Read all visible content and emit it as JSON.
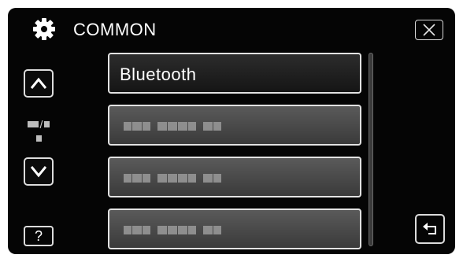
{
  "header": {
    "title": "COMMON",
    "icon": "gear-icon"
  },
  "menu": {
    "items": [
      {
        "label": "Bluetooth",
        "selected": true
      },
      {
        "label": "",
        "placeholder": true
      },
      {
        "label": "",
        "placeholder": true
      },
      {
        "label": "",
        "placeholder": true
      }
    ]
  },
  "nav": {
    "help_label": "?",
    "icons": [
      "chevron-up-icon",
      "chevron-down-icon",
      "close-icon",
      "return-icon"
    ]
  },
  "colors": {
    "background": "#050505",
    "button_border": "#dcdcdc",
    "item_fill": "#4a4a4a",
    "text": "#ffffff"
  }
}
